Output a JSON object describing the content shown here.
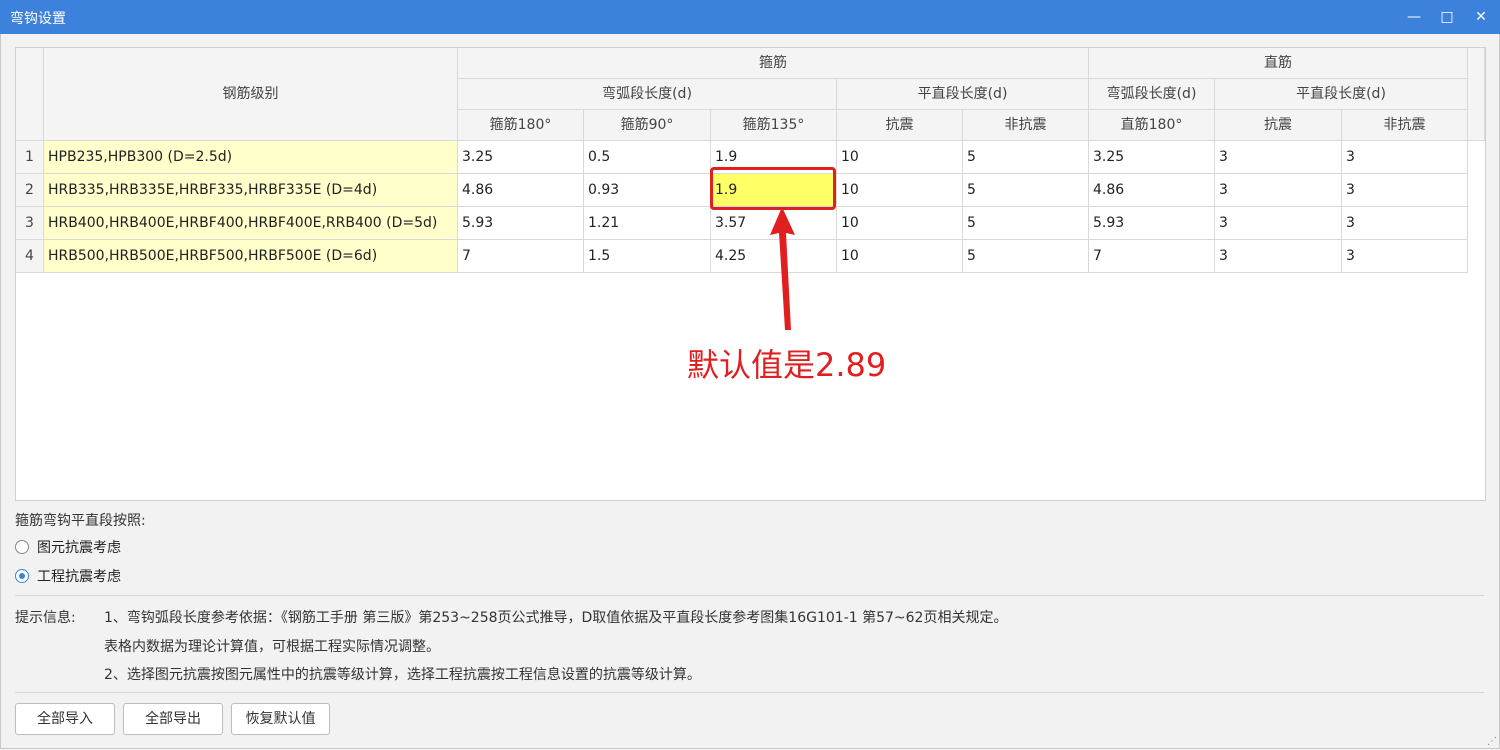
{
  "window": {
    "title": "弯钩设置",
    "minimize_glyph": "—",
    "maximize_glyph": "□",
    "close_glyph": "✕"
  },
  "table": {
    "header": {
      "grade": "钢筋级别",
      "stirrup": "箍筋",
      "straight": "直筋",
      "arc_len": "弯弧段长度(d)",
      "flat_len": "平直段长度(d)",
      "s180": "箍筋180°",
      "s90": "箍筋90°",
      "s135": "箍筋135°",
      "seismic": "抗震",
      "non_seismic": "非抗震",
      "z180": "直筋180°"
    },
    "rows": [
      {
        "no": "1",
        "grade": "HPB235,HPB300 (D=2.5d)",
        "c1": "3.25",
        "c2": "0.5",
        "c3": "1.9",
        "c4": "10",
        "c5": "5",
        "c6": "3.25",
        "c7": "3",
        "c8": "3"
      },
      {
        "no": "2",
        "grade": "HRB335,HRB335E,HRBF335,HRBF335E (D=4d)",
        "c1": "4.86",
        "c2": "0.93",
        "c3": "1.9",
        "c4": "10",
        "c5": "5",
        "c6": "4.86",
        "c7": "3",
        "c8": "3"
      },
      {
        "no": "3",
        "grade": "HRB400,HRB400E,HRBF400,HRBF400E,RRB400 (D=5d)",
        "c1": "5.93",
        "c2": "1.21",
        "c3": "3.57",
        "c4": "10",
        "c5": "5",
        "c6": "5.93",
        "c7": "3",
        "c8": "3"
      },
      {
        "no": "4",
        "grade": "HRB500,HRB500E,HRBF500,HRBF500E (D=6d)",
        "c1": "7",
        "c2": "1.5",
        "c3": "4.25",
        "c4": "10",
        "c5": "5",
        "c6": "7",
        "c7": "3",
        "c8": "3"
      }
    ]
  },
  "annotation": {
    "text": "默认值是2.89",
    "color": "#e02020"
  },
  "options": {
    "title": "箍筋弯钩平直段按照:",
    "radio1": "图元抗震考虑",
    "radio2": "工程抗震考虑",
    "selected": "radio2"
  },
  "tips": {
    "label": "提示信息:",
    "line1": "1、弯钩弧段长度参考依据：《钢筋工手册 第三版》第253~258页公式推导，D取值依据及平直段长度参考图集16G101-1 第57~62页相关规定。",
    "line2": "表格内数据为理论计算值，可根据工程实际情况调整。",
    "line3": "2、选择图元抗震按图元属性中的抗震等级计算，选择工程抗震按工程信息设置的抗震等级计算。"
  },
  "buttons": {
    "import_all": "全部导入",
    "export_all": "全部导出",
    "restore_default": "恢复默认值"
  },
  "colors": {
    "titlebar": "#3c82dc",
    "grade_cell_bg": "#ffffcc",
    "highlight_cell_bg": "#ffff66"
  }
}
